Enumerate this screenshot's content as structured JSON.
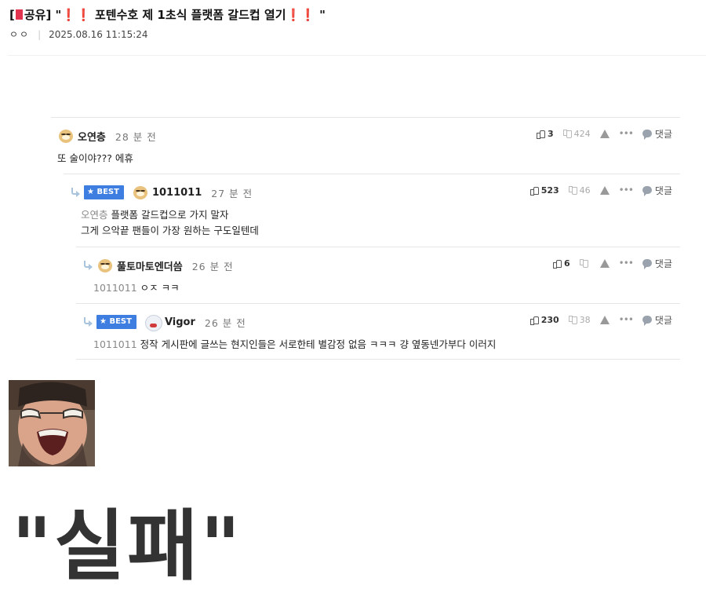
{
  "post": {
    "tag": "[",
    "category": "공유]",
    "title_prefix": " \"",
    "excl_a": "❗",
    "excl_b": "❗",
    "title_main": " 포텐수호 제 1초식 플랫폼 갈드컵 열기",
    "excl_c": "❗",
    "excl_d": "❗",
    "title_suffix": " \"",
    "author": "ㅇㅇ",
    "datetime": "2025.08.16 11:15:24"
  },
  "comments": [
    {
      "nick": "오연층",
      "time": "28 분 전",
      "best": false,
      "avatar": "dog-avatar",
      "up": "3",
      "down": "424",
      "reply_label": "댓글",
      "to": "",
      "lines": [
        "또 술이야??? 에휴"
      ]
    },
    {
      "nick": "1011011",
      "time": "27 분 전",
      "best": true,
      "best_label": "BEST",
      "avatar": "dog-avatar",
      "up": "523",
      "down": "46",
      "reply_label": "댓글",
      "to": "오연층",
      "lines": [
        "플랫폼 갈드컵으로 가지 말자",
        "그게 으악끝 팬들이 가장 원하는 구도일텐데"
      ]
    },
    {
      "nick": "풀토마토엔더씀",
      "time": "26 분 전",
      "best": false,
      "avatar": "dog-avatar",
      "up": "6",
      "down": "",
      "reply_label": "댓글",
      "to": "1011011",
      "lines": [
        "ㅇㅈ ㅋㅋ"
      ]
    },
    {
      "nick": "Vigor",
      "time": "26 분 전",
      "best": true,
      "best_label": "BEST",
      "avatar": "polar-bear-avatar",
      "up": "230",
      "down": "38",
      "reply_label": "댓글",
      "to": "1011011",
      "lines": [
        "정작 게시판에 글쓰는 현지인들은 서로한테 별감정 없음 ㅋㅋㅋ 걍 옆동넨가부다 이러지"
      ]
    }
  ],
  "caption": "\"실패\"",
  "colors": {
    "best_badge": "#3d7ee0",
    "title_flag": "#e2334f",
    "exclamation": "#e53232"
  }
}
